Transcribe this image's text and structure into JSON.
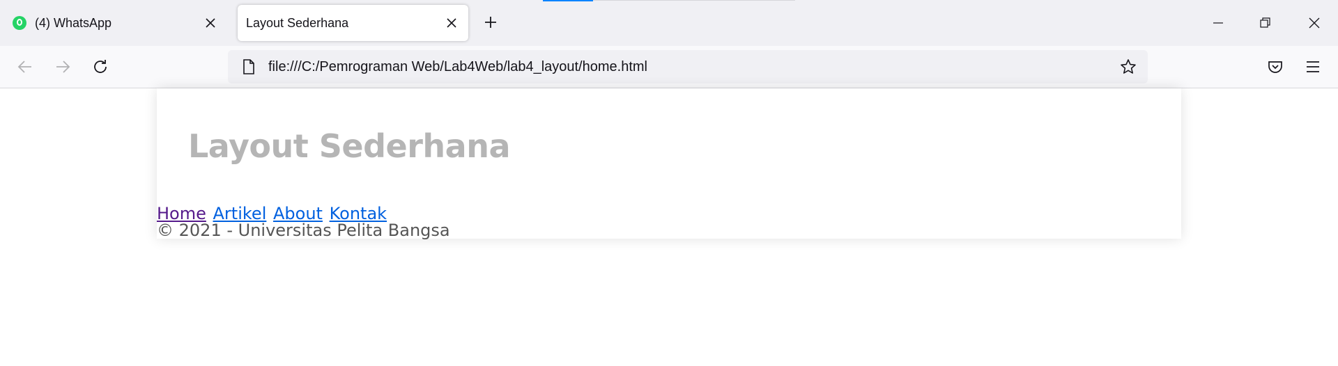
{
  "browser": {
    "tabs": [
      {
        "title": "(4) WhatsApp",
        "icon": "whatsapp-icon",
        "active": false
      },
      {
        "title": "Layout Sederhana",
        "icon": "",
        "active": true
      }
    ],
    "url": "file:///C:/Pemrograman Web/Lab4Web/lab4_layout/home.html"
  },
  "page": {
    "header_title": "Layout Sederhana",
    "nav": {
      "home": "Home",
      "artikel": "Artikel",
      "about": "About",
      "kontak": "Kontak"
    },
    "footer": "© 2021 - Universitas Pelita Bangsa"
  },
  "colors": {
    "title_gray": "#b5b5b5",
    "link_blue": "#0060df",
    "link_visited": "#551a8b",
    "accent": "#0a84ff"
  }
}
